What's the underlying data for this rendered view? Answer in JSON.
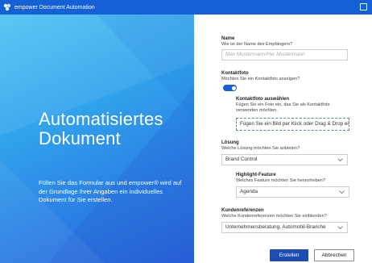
{
  "window": {
    "title": "empower Document Automation"
  },
  "hero": {
    "headline_line1": "Automatisiertes",
    "headline_line2": "Dokument",
    "subtitle": "Füllen Sie das Formular aus und empower® wird auf der Grundlage Ihrer Angaben ein individuelles Dokument für Sie erstellen."
  },
  "form": {
    "name": {
      "label": "Name",
      "hint": "Wie ist der Name des Empfängers?",
      "placeholder": "Max Mustermann/Her Mustermann",
      "value": ""
    },
    "photo": {
      "label": "Kontaktfoto",
      "hint": "Möchten Sie ein Kontaktfoto anzeigen?",
      "toggle_on": true
    },
    "photo_select": {
      "label": "Kontaktfoto auswählen",
      "hint": "Fügen Sie ein Foto ein, das Sie als Kontaktfoto verwenden möchten.",
      "dropzone": "Fügen Sie ein Bild per Klick oder Drag & Drop ein"
    },
    "solution": {
      "label": "Lösung",
      "hint": "Welche Lösung möchten Sie anbieten?",
      "value": "Brand Control"
    },
    "highlight": {
      "label": "Highlight-Feature",
      "hint": "Welches Feature möchten Sie hervorheben?",
      "value": "Agenda"
    },
    "references": {
      "label": "Kundenreferenzen",
      "hint": "Welche Kundenreferenzen möchten Sie einblenden?",
      "value": "Unternehmensberatung, Automobil-Branche"
    },
    "buttons": {
      "create": "Erstellen",
      "cancel": "Abbrechen"
    }
  },
  "colors": {
    "titlebar": "#1560d6",
    "primary_button": "#1b4db3",
    "toggle": "#1560d6",
    "hero_gradient_start": "#4fc4f3",
    "hero_gradient_end": "#2a62d8"
  },
  "icons": {
    "app": "empower-logo-icon",
    "window": "maximize-icon",
    "dropdown": "chevron-down-icon"
  }
}
